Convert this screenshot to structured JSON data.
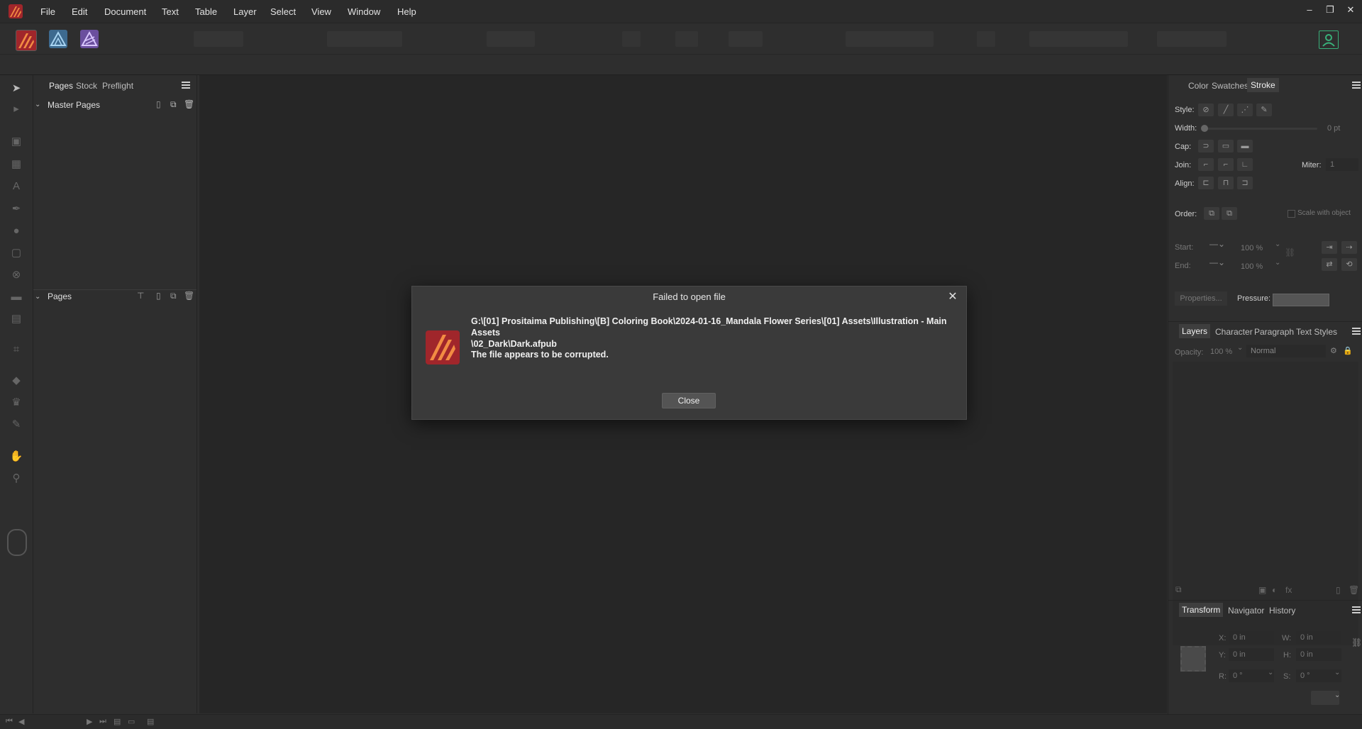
{
  "menu": [
    "File",
    "Edit",
    "Document",
    "Text",
    "Table",
    "Layer",
    "Select",
    "View",
    "Window",
    "Help"
  ],
  "left_panel": {
    "tabs": [
      "Pages",
      "Stock",
      "Preflight"
    ],
    "master_pages_label": "Master Pages",
    "pages_label": "Pages"
  },
  "right_panel": {
    "top_tabs": [
      "Color",
      "Swatches",
      "Stroke"
    ],
    "stroke": {
      "style_label": "Style:",
      "width_label": "Width:",
      "width_value": "0 pt",
      "cap_label": "Cap:",
      "join_label": "Join:",
      "miter_label": "Miter:",
      "miter_value": "1",
      "align_label": "Align:",
      "order_label": "Order:",
      "scale_label": "Scale with object",
      "start_label": "Start:",
      "end_label": "End:",
      "start_pct": "100 %",
      "end_pct": "100 %",
      "properties_label": "Properties...",
      "pressure_label": "Pressure:"
    },
    "layer_tabs": [
      "Layers",
      "Character",
      "Paragraph",
      "Text Styles"
    ],
    "layers": {
      "opacity_label": "Opacity:",
      "opacity_value": "100 %",
      "blend_mode": "Normal"
    },
    "transform_tabs": [
      "Transform",
      "Navigator",
      "History"
    ],
    "transform": {
      "x_label": "X:",
      "x_value": "0 in",
      "y_label": "Y:",
      "y_value": "0 in",
      "w_label": "W:",
      "w_value": "0 in",
      "h_label": "H:",
      "h_value": "0 in",
      "r_label": "R:",
      "r_value": "0 °",
      "s_label": "S:",
      "s_value": "0 °"
    }
  },
  "dialog": {
    "title": "Failed to open file",
    "message": "G:\\[01] Prositaima Publishing\\[B] Coloring Book\\2024-01-16_Mandala Flower Series\\[01] Assets\\Illustration - Main Assets\n\\02_Dark\\Dark.afpub",
    "sub_message": "The file appears to be corrupted.",
    "close_label": "Close"
  },
  "colors": {
    "publisher_red": "#a0262b",
    "designer_blue": "#4a8fc4",
    "photo_purple": "#8a6dc9",
    "account_green": "#39b07a"
  }
}
